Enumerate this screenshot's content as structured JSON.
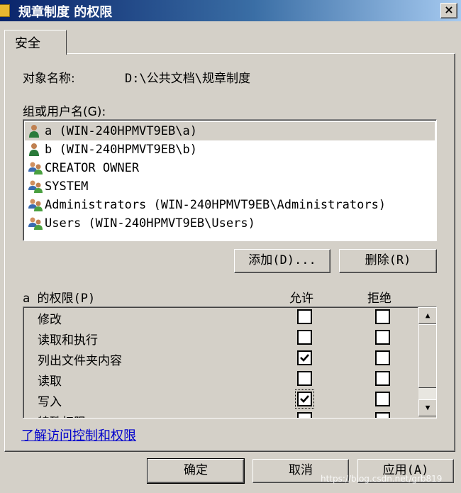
{
  "window": {
    "title": "规章制度 的权限",
    "close_glyph": "×"
  },
  "tabs": [
    {
      "label": "安全"
    }
  ],
  "object": {
    "label": "对象名称:",
    "value": "D:\\公共文档\\规章制度"
  },
  "groups": {
    "label": "组或用户名(G):",
    "items": [
      {
        "name": "a (WIN-240HPMVT9EB\\a)",
        "icon": "user-icon",
        "selected": true
      },
      {
        "name": "b (WIN-240HPMVT9EB\\b)",
        "icon": "user-icon",
        "selected": false
      },
      {
        "name": "CREATOR OWNER",
        "icon": "group-icon",
        "selected": false
      },
      {
        "name": "SYSTEM",
        "icon": "group-icon",
        "selected": false
      },
      {
        "name": "Administrators (WIN-240HPMVT9EB\\Administrators)",
        "icon": "group-icon",
        "selected": false
      },
      {
        "name": "Users (WIN-240HPMVT9EB\\Users)",
        "icon": "group-icon",
        "selected": false
      }
    ]
  },
  "buttons": {
    "add": "添加(D)...",
    "remove": "删除(R)",
    "ok": "确定",
    "cancel": "取消",
    "apply": "应用(A)"
  },
  "permissions": {
    "label": "a 的权限(P)",
    "allow_header": "允许",
    "deny_header": "拒绝",
    "rows": [
      {
        "name": "修改",
        "allow": false,
        "deny": false
      },
      {
        "name": "读取和执行",
        "allow": false,
        "deny": false
      },
      {
        "name": "列出文件夹内容",
        "allow": true,
        "deny": false
      },
      {
        "name": "读取",
        "allow": false,
        "deny": false
      },
      {
        "name": "写入",
        "allow": true,
        "deny": false
      },
      {
        "name": "特殊权限",
        "allow": false,
        "deny": false
      }
    ]
  },
  "help_link": "了解访问控制和权限",
  "watermark": "https://blog.csdn.net/grb819",
  "colors": {
    "titlebar_start": "#0a246a",
    "titlebar_end": "#a6caf0",
    "face": "#d4d0c8",
    "link": "#0000cc"
  }
}
